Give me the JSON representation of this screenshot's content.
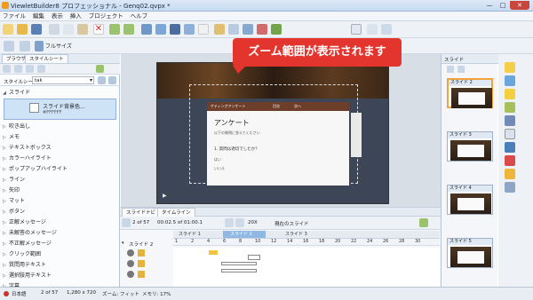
{
  "window": {
    "title": "ViewletBuilder8 プロフェッショナル - Genq02.qvpx *",
    "minimize": "—",
    "maximize": "□",
    "close": "✕"
  },
  "menu": [
    "ファイル",
    "編集",
    "表示",
    "挿入",
    "プロジェクト",
    "ヘルプ"
  ],
  "toolbar2": {
    "fullsize_label": "フルサイズ"
  },
  "left_panel": {
    "tabs": [
      "ブラウザ",
      "スタイルシート"
    ],
    "stylesheet_label": "スタイルシート",
    "stylesheet_value": "tak",
    "selected_section": "スライド",
    "selected_item_title": "スライド背景色...",
    "selected_item_sub": "#FFFFFF",
    "items": [
      "吹き出し",
      "メモ",
      "テキストボックス",
      "カラーハイライト",
      "ポップアップハイライト",
      "ライン",
      "矢印",
      "マット",
      "ボタン",
      "正解メッセージ",
      "未解答のメッセージ",
      "不正解メッセージ",
      "クリック範囲",
      "質問用テキスト",
      "選択肢用テキスト",
      "字幕"
    ]
  },
  "callout": {
    "text": "ズーム範囲が表示されます"
  },
  "stage": {
    "card_header": "ケティングアンケート",
    "card_tab1": "目次",
    "card_tab2": "次へ",
    "card_title": "アンケート",
    "card_line1": "以下の質問に答えてください",
    "card_q1": "1. 質問は適切でしたか？",
    "card_opt1": "はい",
    "card_opt2": "いいえ"
  },
  "timeline": {
    "tabs": [
      "スライドナビ",
      "タイムライン"
    ],
    "slide_counter": "2 of 57",
    "time": "00:02.5 of 01:00.1",
    "zoom": "20X",
    "position_label": "現在のスライド",
    "ruler_left": "スライド 1",
    "ruler_current": "スライド 2",
    "ruler_right": "スライド 3",
    "ruler_numbers": [
      "1",
      "2",
      "4",
      "6",
      "8",
      "10",
      "12",
      "14",
      "16",
      "18",
      "20",
      "22",
      "24",
      "26",
      "28",
      "30"
    ],
    "track_label": "スライド 2"
  },
  "right_panel": {
    "header": "スライド",
    "thumbs": [
      "スライド 2",
      "スライド 3",
      "スライド 4",
      "スライド 5"
    ]
  },
  "status": {
    "language": "日本語",
    "slide": "2 of 57",
    "size": "1,280 x 720",
    "zoom": "ズーム: フィット",
    "memory": "メモリ: 17%"
  }
}
